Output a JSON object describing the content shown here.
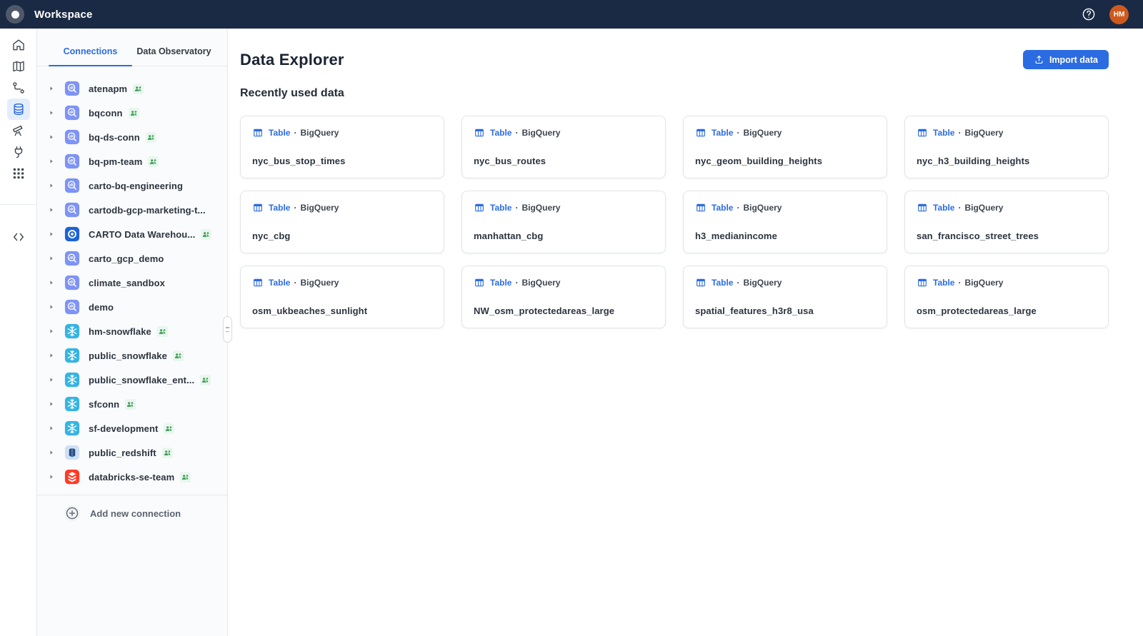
{
  "topbar": {
    "title": "Workspace",
    "avatar_initials": "HM"
  },
  "ui": {
    "dot": "·"
  },
  "rail": {
    "items": [
      "home",
      "maps",
      "workflows",
      "data-explorer",
      "data-observatory",
      "connections",
      "applications",
      "developers"
    ],
    "active_item": "data-explorer"
  },
  "sidebar": {
    "tabs": [
      {
        "label": "Connections",
        "active": true
      },
      {
        "label": "Data Observatory",
        "active": false
      }
    ],
    "connections": [
      {
        "name": "atenapm",
        "type": "bigquery",
        "shared": true
      },
      {
        "name": "bqconn",
        "type": "bigquery",
        "shared": true
      },
      {
        "name": "bq-ds-conn",
        "type": "bigquery",
        "shared": true
      },
      {
        "name": "bq-pm-team",
        "type": "bigquery",
        "shared": true
      },
      {
        "name": "carto-bq-engineering",
        "type": "bigquery",
        "shared": false
      },
      {
        "name": "cartodb-gcp-marketing-t...",
        "type": "bigquery",
        "shared": false
      },
      {
        "name": "CARTO Data Warehou...",
        "type": "carto",
        "shared": true
      },
      {
        "name": "carto_gcp_demo",
        "type": "bigquery",
        "shared": false
      },
      {
        "name": "climate_sandbox",
        "type": "bigquery",
        "shared": false
      },
      {
        "name": "demo",
        "type": "bigquery",
        "shared": false
      },
      {
        "name": "hm-snowflake",
        "type": "snowflake",
        "shared": true
      },
      {
        "name": "public_snowflake",
        "type": "snowflake",
        "shared": true
      },
      {
        "name": "public_snowflake_ent...",
        "type": "snowflake",
        "shared": true
      },
      {
        "name": "sfconn",
        "type": "snowflake",
        "shared": true
      },
      {
        "name": "sf-development",
        "type": "snowflake",
        "shared": true
      },
      {
        "name": "public_redshift",
        "type": "redshift",
        "shared": true
      },
      {
        "name": "databricks-se-team",
        "type": "databricks",
        "shared": true
      }
    ],
    "add_new_label": "Add new connection"
  },
  "main": {
    "title": "Data Explorer",
    "import_button_label": "Import data",
    "section_title": "Recently used data",
    "cards": [
      {
        "type_label": "Table",
        "provider": "BigQuery",
        "name": "nyc_bus_stop_times"
      },
      {
        "type_label": "Table",
        "provider": "BigQuery",
        "name": "nyc_bus_routes"
      },
      {
        "type_label": "Table",
        "provider": "BigQuery",
        "name": "nyc_geom_building_heights"
      },
      {
        "type_label": "Table",
        "provider": "BigQuery",
        "name": "nyc_h3_building_heights"
      },
      {
        "type_label": "Table",
        "provider": "BigQuery",
        "name": "nyc_cbg"
      },
      {
        "type_label": "Table",
        "provider": "BigQuery",
        "name": "manhattan_cbg"
      },
      {
        "type_label": "Table",
        "provider": "BigQuery",
        "name": "h3_medianincome"
      },
      {
        "type_label": "Table",
        "provider": "BigQuery",
        "name": "san_francisco_street_trees"
      },
      {
        "type_label": "Table",
        "provider": "BigQuery",
        "name": "osm_ukbeaches_sunlight"
      },
      {
        "type_label": "Table",
        "provider": "BigQuery",
        "name": "NW_osm_protectedareas_large"
      },
      {
        "type_label": "Table",
        "provider": "BigQuery",
        "name": "spatial_features_h3r8_usa"
      },
      {
        "type_label": "Table",
        "provider": "BigQuery",
        "name": "osm_protectedareas_large"
      }
    ]
  },
  "colors": {
    "topbar_bg": "#1b2a44",
    "accent_blue": "#2b6ce2",
    "avatar_orange": "#ce5a1e",
    "shared_green": "#3f9e57",
    "bigquery_icon": "#7e93f5",
    "carto_icon": "#1e63d6",
    "snowflake_icon": "#35b4e3",
    "databricks_icon": "#ff3a26",
    "redshift_icon_bg": "#cfe0f4"
  }
}
